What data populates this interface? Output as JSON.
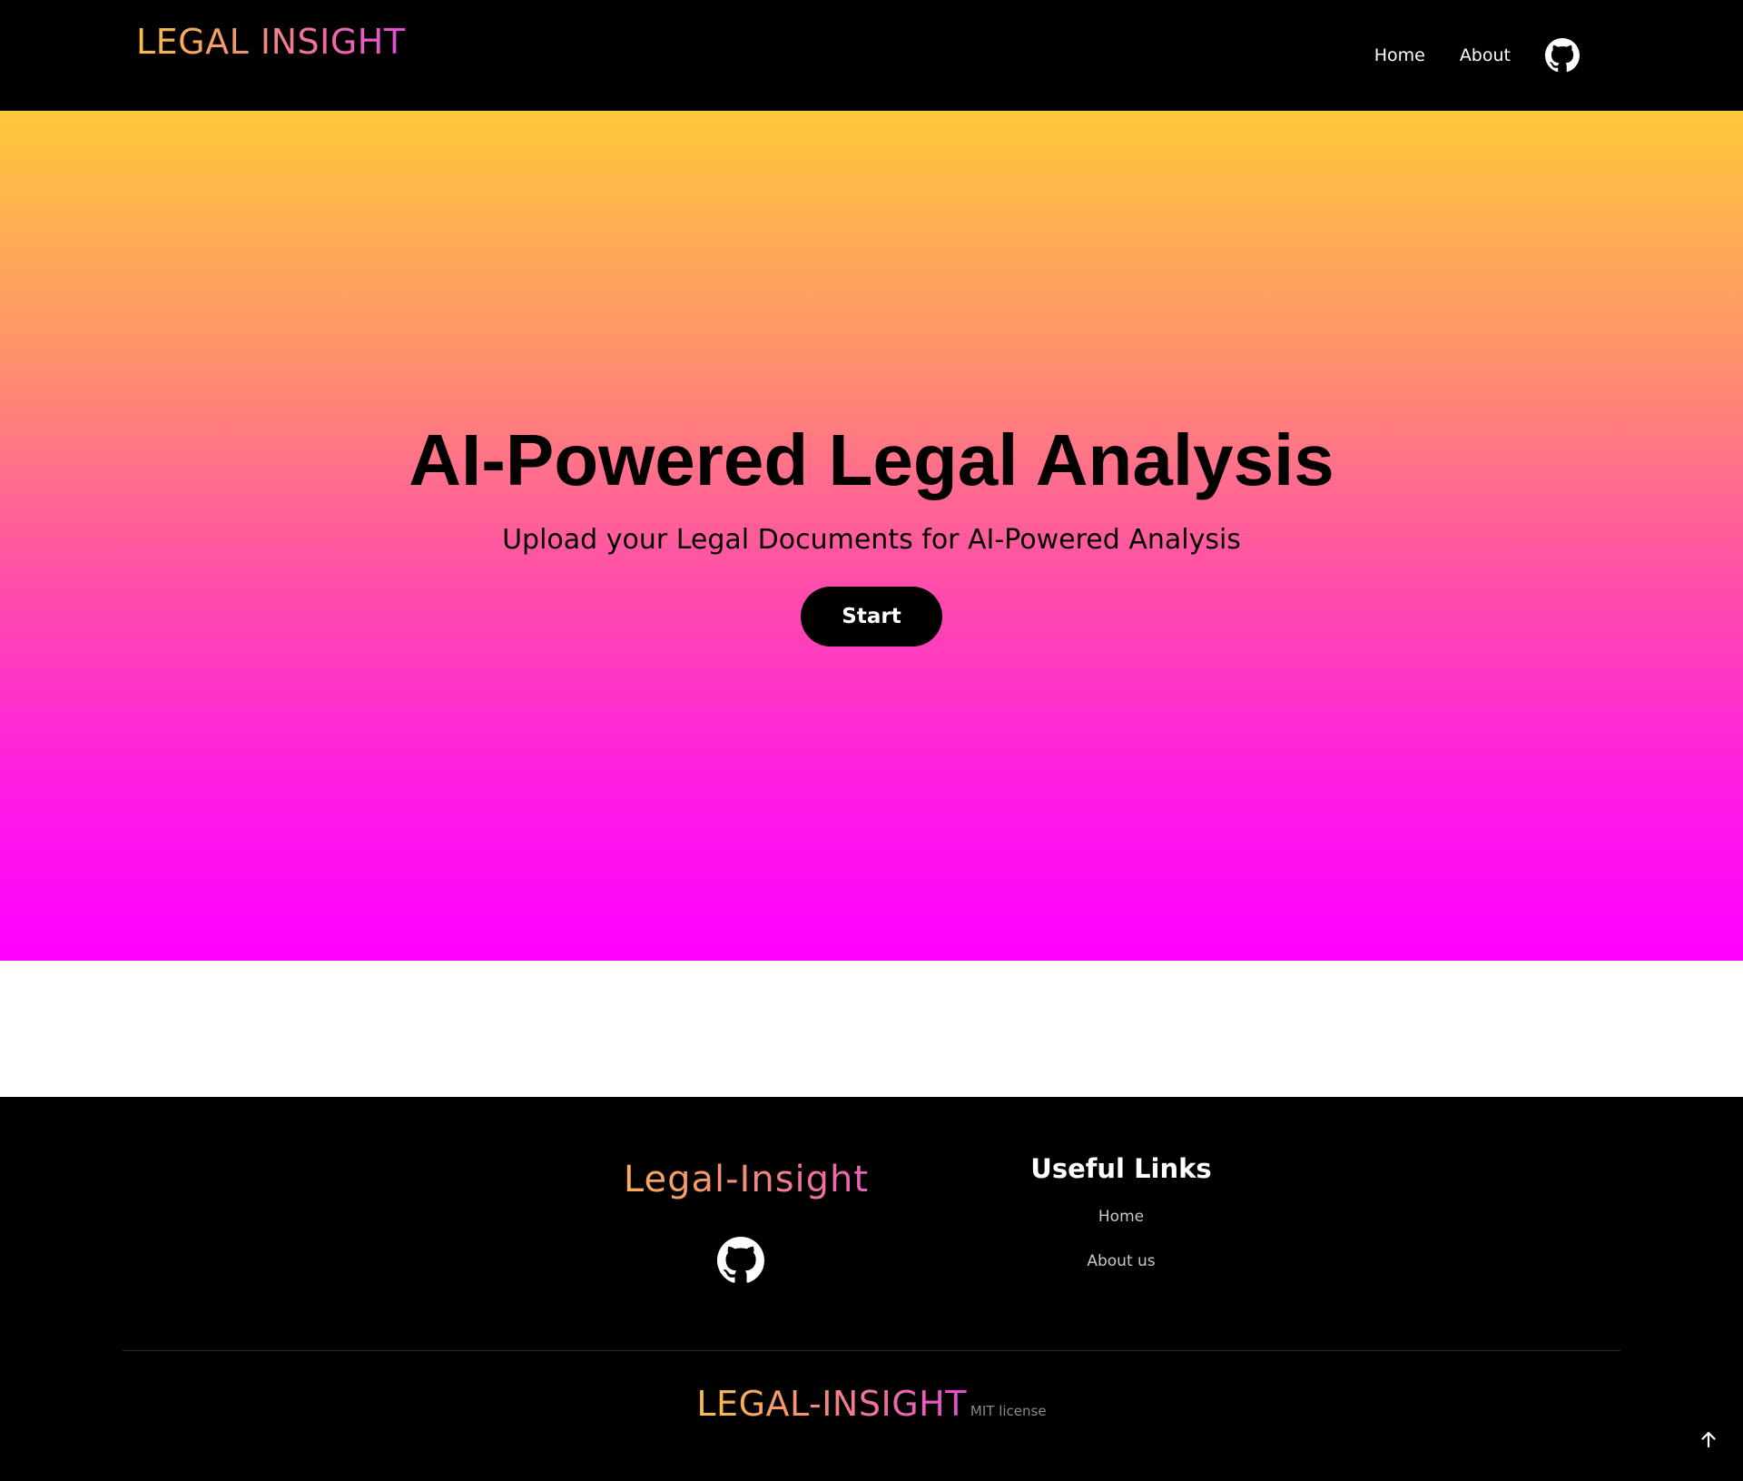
{
  "header": {
    "brand": "LEGAL INSIGHT",
    "nav": [
      {
        "label": "Home"
      },
      {
        "label": "About"
      }
    ],
    "github_icon": "github-icon"
  },
  "hero": {
    "title": "AI-Powered Legal Analysis",
    "subtitle": "Upload your Legal Documents for AI-Powered Analysis",
    "start_label": "Start"
  },
  "footer": {
    "brand": "Legal-Insight",
    "github_icon": "github-icon",
    "links_title": "Useful Links",
    "links": [
      {
        "label": "Home"
      },
      {
        "label": "About us"
      }
    ],
    "bottom_brand": "LEGAL-INSIGHT",
    "license": "MIT license",
    "back_to_top_icon": "arrow-up-icon"
  },
  "colors": {
    "header_bg": "#000000",
    "gradient_top": "#ffc83a",
    "gradient_bottom": "#ff00ff",
    "brand_gradient_start": "#f7c14a",
    "brand_gradient_end": "#e44bd8",
    "button_bg": "#000000"
  }
}
